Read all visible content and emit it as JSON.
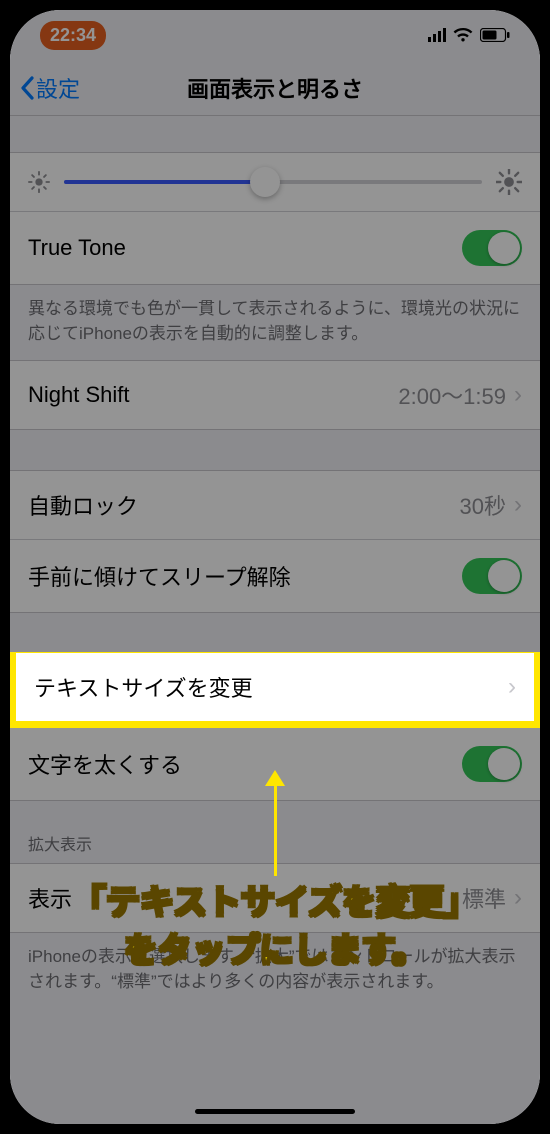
{
  "statusbar": {
    "time": "22:34"
  },
  "nav": {
    "back": "設定",
    "title": "画面表示と明るさ"
  },
  "truetone": {
    "label": "True Tone",
    "desc": "異なる環境でも色が一貫して表示されるように、環境光の状況に応じてiPhoneの表示を自動的に調整します。"
  },
  "nightshift": {
    "label": "Night Shift",
    "value": "2:00〜1:59"
  },
  "autolock": {
    "label": "自動ロック",
    "value": "30秒"
  },
  "raise": {
    "label": "手前に傾けてスリープ解除"
  },
  "textsize": {
    "label": "テキストサイズを変更"
  },
  "bold": {
    "label": "文字を太くする"
  },
  "zoom": {
    "header": "拡大表示",
    "label": "表示",
    "value": "標準",
    "desc": "iPhoneの表示を選択します。“拡大”ではコントロールが拡大表示されます。“標準”ではより多くの内容が表示されます。"
  },
  "annotation": {
    "line1": "「テキストサイズを変更」",
    "line2": "をタップにします。"
  }
}
